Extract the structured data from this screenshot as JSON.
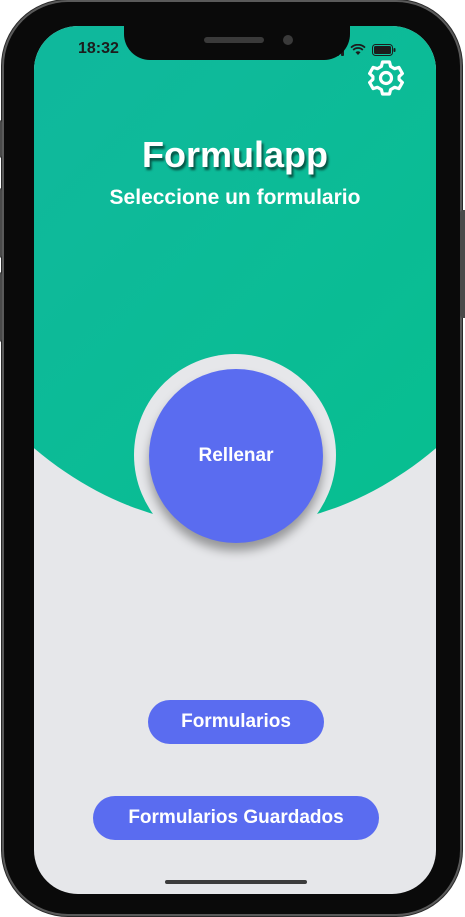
{
  "status_bar": {
    "time": "18:32"
  },
  "header": {
    "title": "Formulapp",
    "subtitle": "Seleccione un formulario"
  },
  "actions": {
    "fill_label": "Rellenar",
    "forms_label": "Formularios",
    "saved_forms_label": "Formularios Guardados"
  },
  "icons": {
    "settings": "gear-icon",
    "signal": "signal-icon",
    "wifi": "wifi-icon",
    "battery": "battery-icon"
  },
  "colors": {
    "gradient_start": "#10b4a4",
    "gradient_end": "#05c08d",
    "accent": "#5a6cf0",
    "background": "#e6e7ea"
  }
}
